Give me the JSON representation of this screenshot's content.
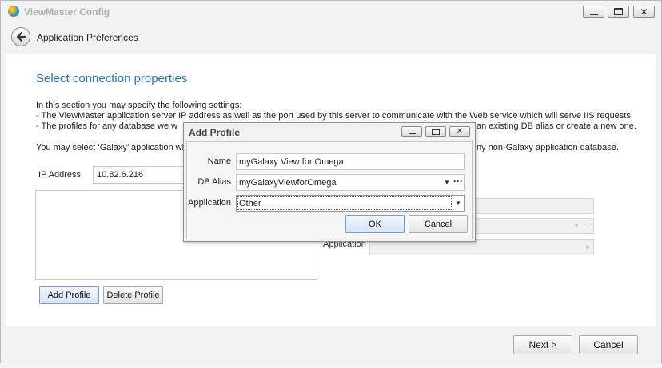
{
  "window": {
    "title": "ViewMaster Config"
  },
  "nav": {
    "title": "Application Preferences"
  },
  "content": {
    "section_title": "Select connection properties",
    "intro": "In this section you may specify the following settings:",
    "bullet1": "-   The ViewMaster application server IP address as well as the port used by this server to communicate with the Web service which will serve IIS requests.",
    "bullet2_left": "-   The profiles for any database we w",
    "bullet2_right": "an existing DB alias or create a new one.",
    "note_left": "You may select ‘Galaxy’ application whe",
    "note_right": "ny non-Galaxy application database.",
    "ip_label": "IP Address",
    "ip_value": "10.82.6.216",
    "application_label": "Application",
    "add_profile_label": "Add Profile",
    "delete_profile_label": "Delete Profile"
  },
  "footer": {
    "next_label": "Next >",
    "cancel_label": "Cancel"
  },
  "dialog": {
    "title": "Add Profile",
    "name_label": "Name",
    "name_value": "myGalaxy View for Omega",
    "dbalias_label": "DB Alias",
    "dbalias_value": "myGalaxyViewforOmega",
    "application_label": "Application",
    "application_value": "Other",
    "ok_label": "OK",
    "cancel_label": "Cancel"
  },
  "icons": {
    "dropdown_arrow": "▼",
    "ellipsis": "···",
    "close": "✕"
  },
  "colors": {
    "accent": "#2a73b8",
    "primary_button": "#d6e3f5"
  }
}
